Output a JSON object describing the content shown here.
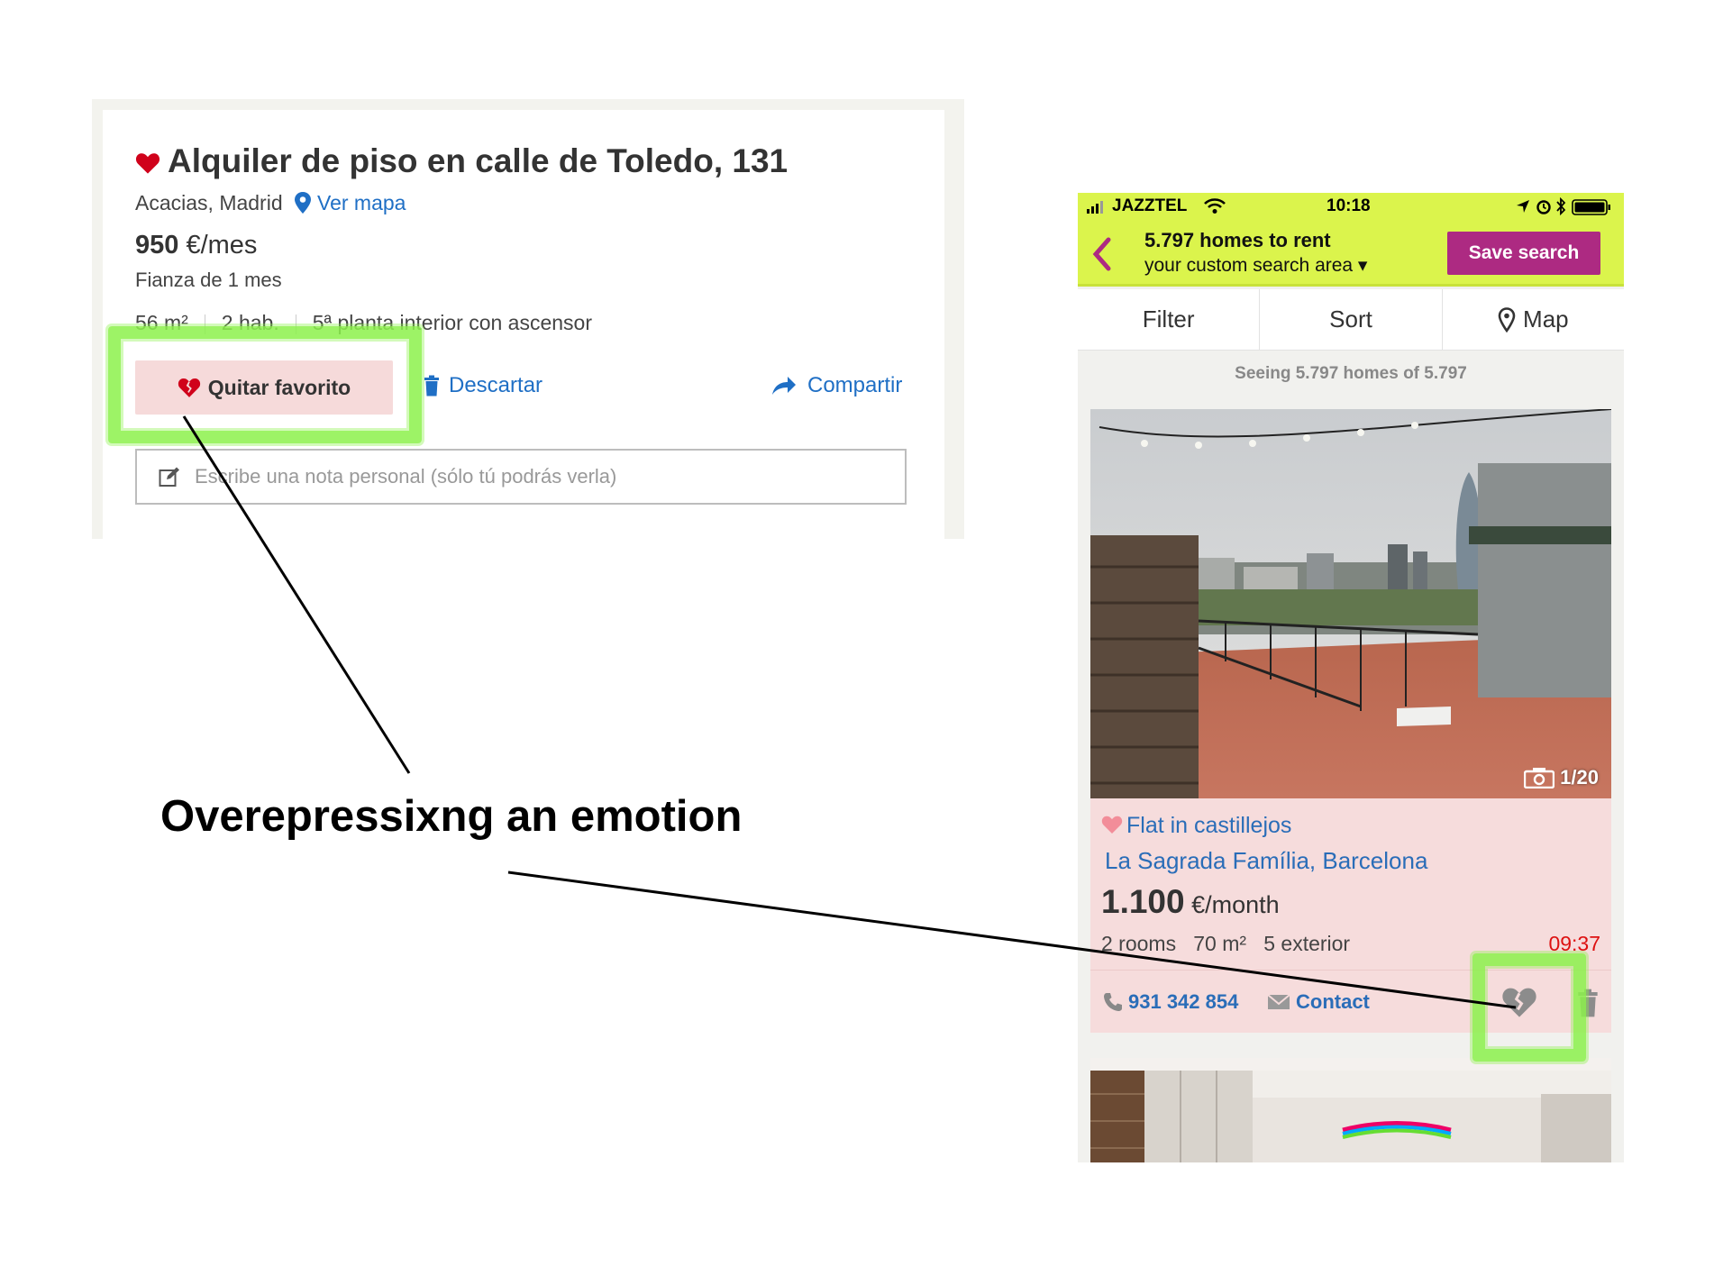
{
  "desktop": {
    "title": "Alquiler de piso en calle de Toledo, 131",
    "location": "Acacias, Madrid",
    "map_link": "Ver mapa",
    "price_value": "950",
    "price_unit": "€/mes",
    "deposit": "Fianza de 1 mes",
    "features": [
      "56 m²",
      "2 hab.",
      "5ª planta interior con ascensor"
    ],
    "unfavorite_label": "Quitar favorito",
    "discard_label": "Descartar",
    "share_label": "Compartir",
    "note_placeholder": "Escribe una nota personal (sólo tú podrás verla)"
  },
  "annotation": {
    "text": "Overepressixng an emotion",
    "highlight_color": "#8cf24c"
  },
  "mobile": {
    "carrier": "JAZZTEL",
    "time": "10:18",
    "header": {
      "count": "5.797 homes to rent",
      "area": "your custom search area ▾",
      "save_search": "Save search"
    },
    "toolbar": {
      "filter": "Filter",
      "sort": "Sort",
      "map": "Map"
    },
    "seeing": "Seeing 5.797 homes of 5.797",
    "listing": {
      "photo_counter": "1/20",
      "title": "Flat in castillejos",
      "location": "La Sagrada Família, Barcelona",
      "price_value": "1.100",
      "price_unit": "€/month",
      "specs": "2 rooms   70 m²   5 exterior",
      "time": "09:37",
      "phone": "931 342 854",
      "contact": "Contact"
    }
  },
  "colors": {
    "brand_green": "#dbf44c",
    "brand_magenta": "#ad2a82",
    "link_blue": "#1f6fc5",
    "favorite_red": "#d0021b",
    "card_pink": "#f6dcdc"
  }
}
